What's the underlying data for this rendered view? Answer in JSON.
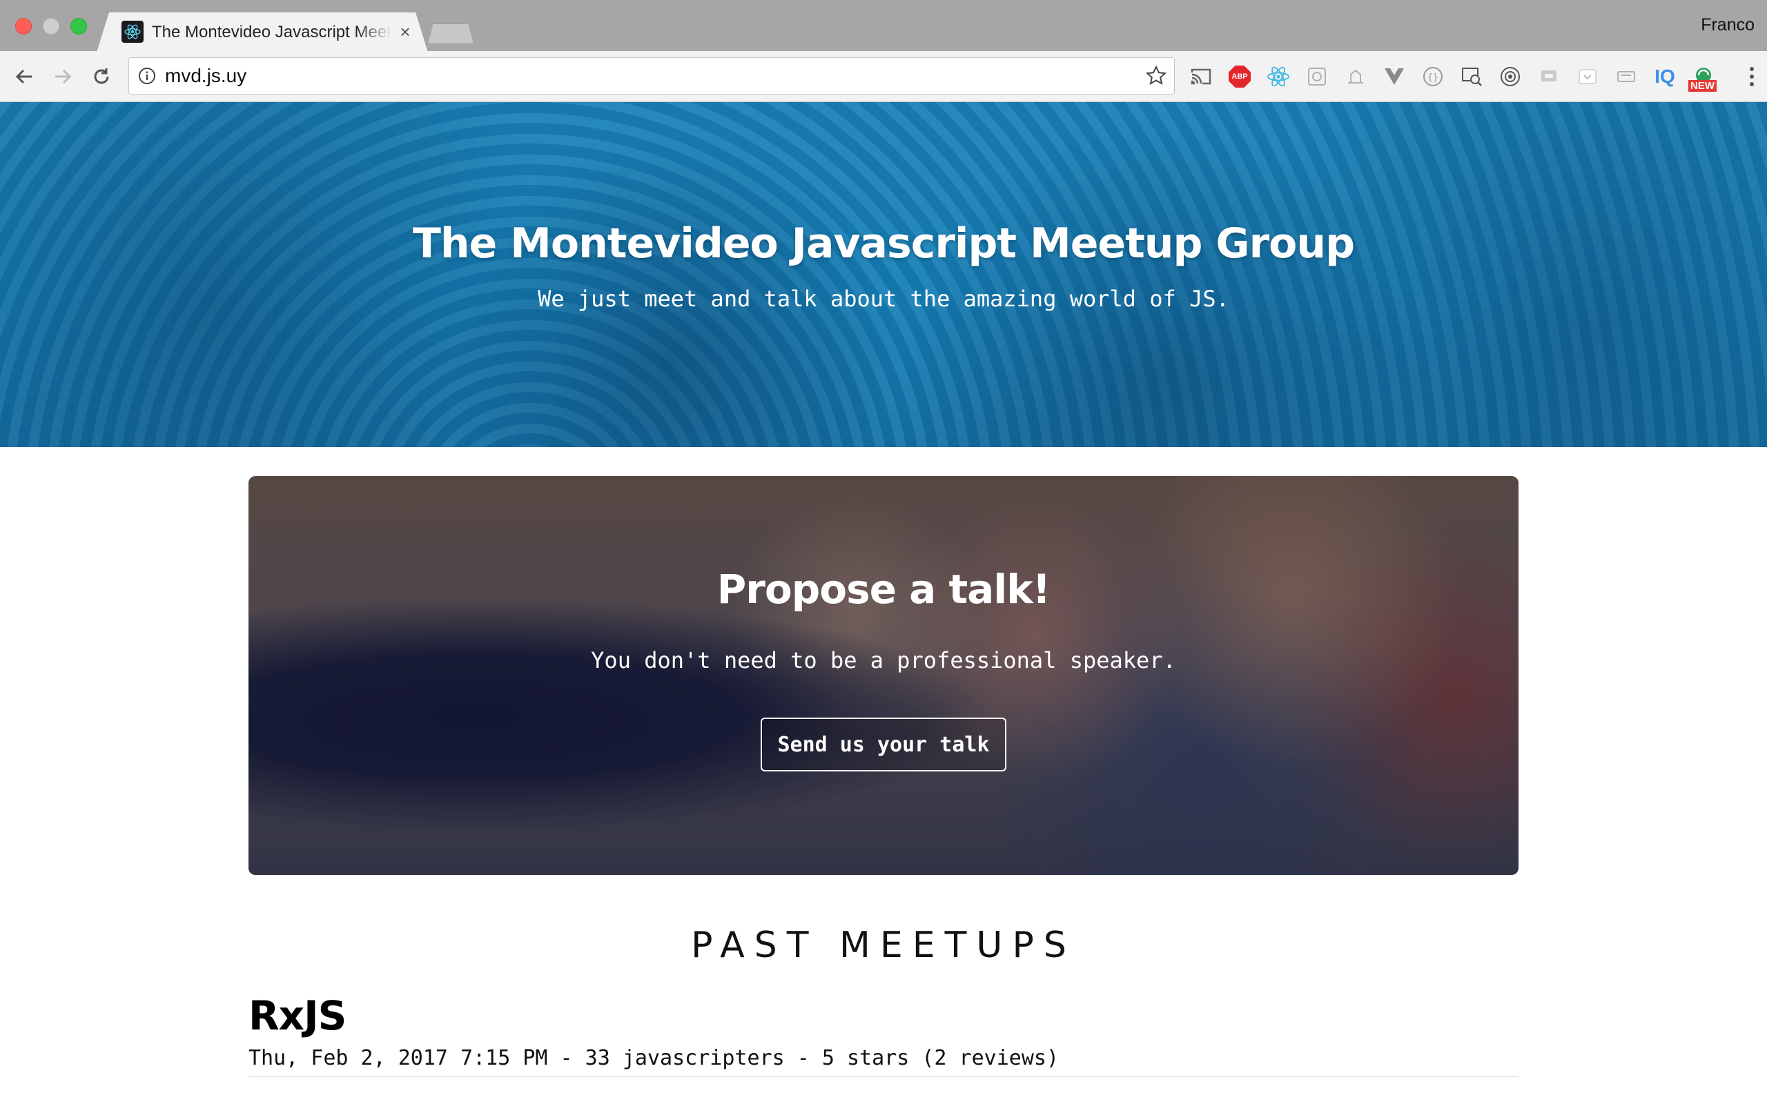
{
  "browser": {
    "tab_title": "The Montevideo Javascript Meetup Group",
    "tab_close": "×",
    "profile_name": "Franco",
    "url": "mvd.js.uy",
    "extensions": [
      "cast-icon",
      "adblock-plus-icon",
      "react-devtools-icon",
      "extension-icon",
      "extension-icon",
      "vue-devtools-icon",
      "json-icon",
      "search-page-icon",
      "chrome-circle-icon",
      "extension-icon",
      "pocket-icon",
      "extension-icon",
      "iq-icon",
      "new-extension-icon"
    ],
    "abp_label": "ABP",
    "iq_label": "IQ",
    "new_badge": "NEW"
  },
  "hero": {
    "title": "The Montevideo Javascript Meetup Group",
    "subtitle": "We just meet and talk about the amazing world of JS.",
    "color": "#1680b7"
  },
  "propose": {
    "title": "Propose a talk!",
    "text": "You don't need to be a professional speaker.",
    "button_label": "Send us your talk"
  },
  "past_meetups": {
    "heading": "PAST MEETUPS",
    "items": [
      {
        "title": "RxJS",
        "meta": "Thu, Feb 2, 2017 7:15 PM - 33 javascripters - 5 stars (2 reviews)"
      }
    ]
  }
}
